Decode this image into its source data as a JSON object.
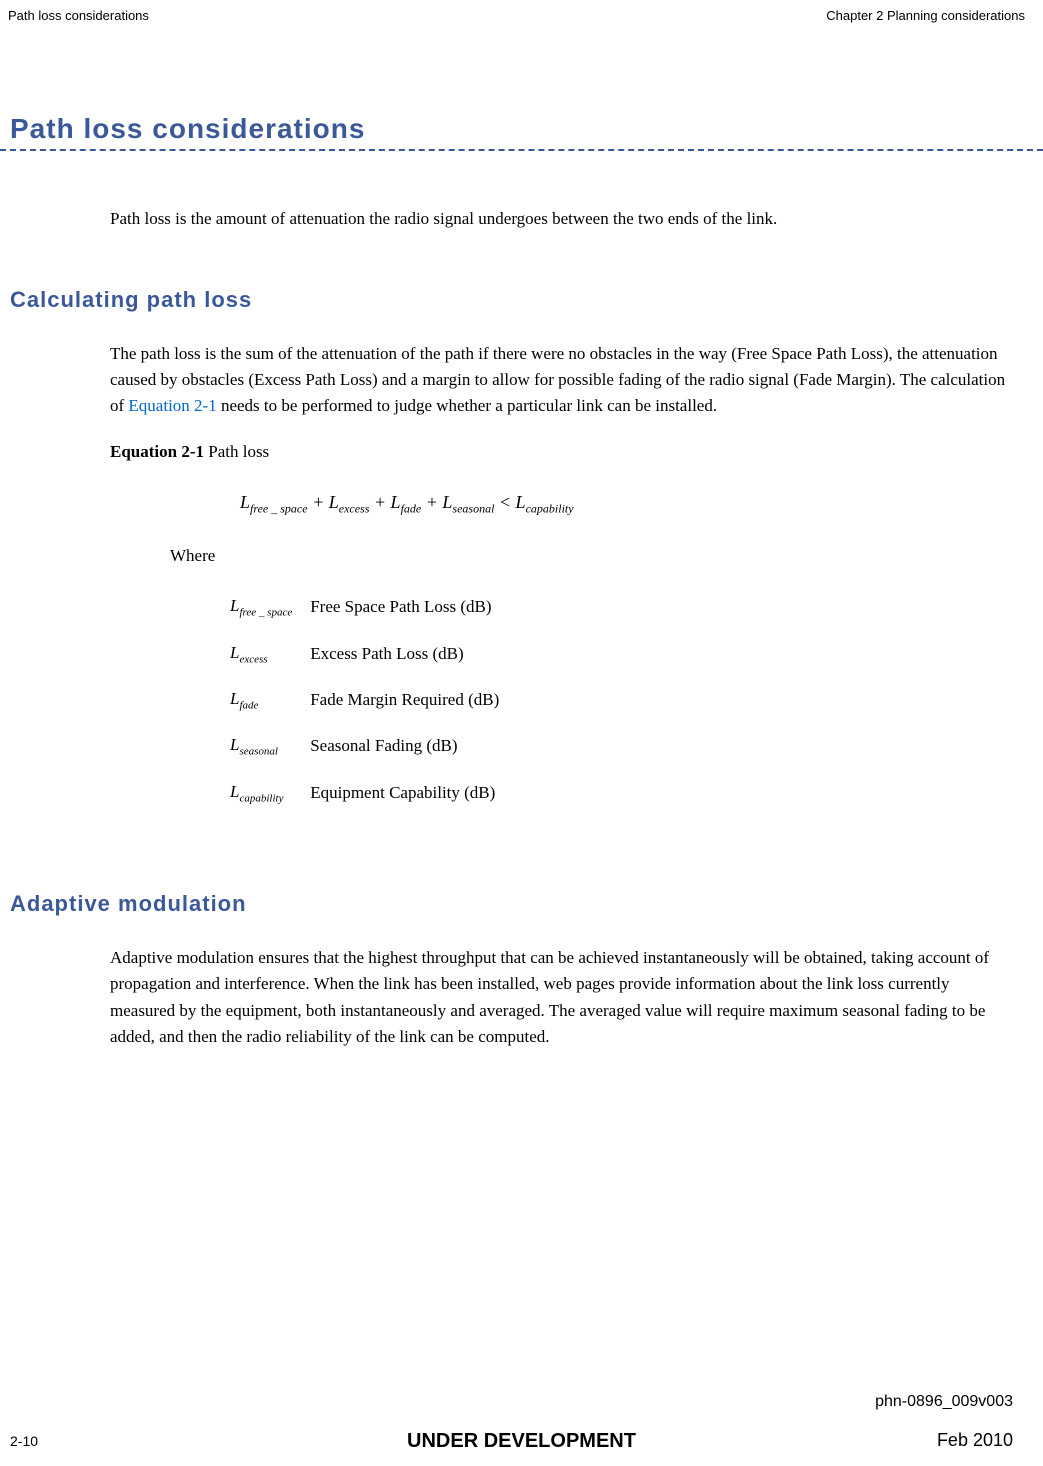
{
  "header": {
    "left": "Path loss considerations",
    "right": "Chapter 2 Planning considerations"
  },
  "title": "Path loss considerations",
  "intro": "Path loss is the amount of attenuation the radio signal undergoes between the two ends of the link.",
  "section1": {
    "heading": "Calculating path loss",
    "para_a": "The path loss is the sum of the attenuation of the path if there were no obstacles in the way (Free Space Path Loss), the attenuation caused by obstacles (Excess Path Loss) and a margin to allow for possible fading of the radio signal (Fade Margin). The calculation of ",
    "link": "Equation 2-1",
    "para_b": " needs to be performed to judge whether a particular link can be installed.",
    "eq_label_bold": "Equation 2-1",
    "eq_label_rest": "  Path loss",
    "where": "Where",
    "terms": [
      {
        "symbol_sub": "free _ space",
        "desc": "Free Space Path Loss (dB)"
      },
      {
        "symbol_sub": "excess",
        "desc": "Excess Path Loss (dB)"
      },
      {
        "symbol_sub": "fade",
        "desc": "Fade Margin Required (dB)"
      },
      {
        "symbol_sub": "seasonal",
        "desc": "Seasonal Fading (dB)"
      },
      {
        "symbol_sub": "capability",
        "desc": "Equipment Capability (dB)"
      }
    ]
  },
  "section2": {
    "heading": "Adaptive modulation",
    "para": "Adaptive modulation ensures that the highest throughput that can be achieved instantaneously will be obtained, taking account of propagation and interference. When the link has been installed, web pages provide information about the link loss currently measured by the equipment, both instantaneously and averaged. The averaged value will require maximum seasonal fading to be added, and then the radio reliability of the link can be computed."
  },
  "footer": {
    "docnum": "phn-0896_009v003",
    "page": "2-10",
    "status": "UNDER DEVELOPMENT",
    "date": "Feb 2010"
  }
}
